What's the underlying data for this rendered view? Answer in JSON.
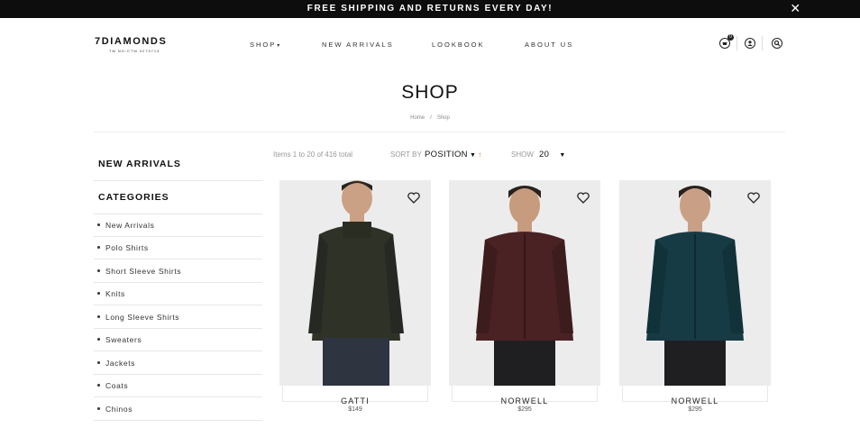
{
  "promo": {
    "text": "FREE SHIPPING AND RETURNS EVERY DAY!",
    "close": "✕"
  },
  "brand": {
    "name": "7DIAMONDS",
    "tagline": "TM NO:CTM 3279714"
  },
  "nav": [
    {
      "label": "SHOP",
      "has_dropdown": true
    },
    {
      "label": "NEW ARRIVALS"
    },
    {
      "label": "LOOKBOOK"
    },
    {
      "label": "ABOUT US"
    }
  ],
  "header_icons": [
    {
      "name": "cart-icon",
      "badge": "0"
    },
    {
      "name": "account-icon"
    },
    {
      "name": "search-icon"
    }
  ],
  "page": {
    "title": "SHOP"
  },
  "breadcrumb": {
    "items": [
      "Home",
      "Shop"
    ],
    "separator": "/"
  },
  "sidebar": {
    "new_arrivals_heading": "NEW ARRIVALS",
    "categories_heading": "CATEGORIES",
    "categories": [
      "New Arrivals",
      "Polo Shirts",
      "Short Sleeve Shirts",
      "Knits",
      "Long Sleeve Shirts",
      "Sweaters",
      "Jackets",
      "Coats",
      "Chinos"
    ]
  },
  "toolbar": {
    "items_count": "Items 1 to 20 of 416 total",
    "sort_label": "SORT BY",
    "sort_value": "POSITION",
    "sort_direction_icon": "↑",
    "show_label": "SHOW",
    "show_value": "20"
  },
  "products": [
    {
      "name": "GATTI",
      "price": "$149",
      "jacket_color": "#2f3327"
    },
    {
      "name": "NORWELL",
      "price": "$295",
      "jacket_color": "#4a2224"
    },
    {
      "name": "NORWELL",
      "price": "$295",
      "jacket_color": "#173b44"
    }
  ],
  "colors": {
    "promo_bg": "#0d0d0d",
    "accent": "#d36a2b",
    "image_bg": "#ececec"
  }
}
